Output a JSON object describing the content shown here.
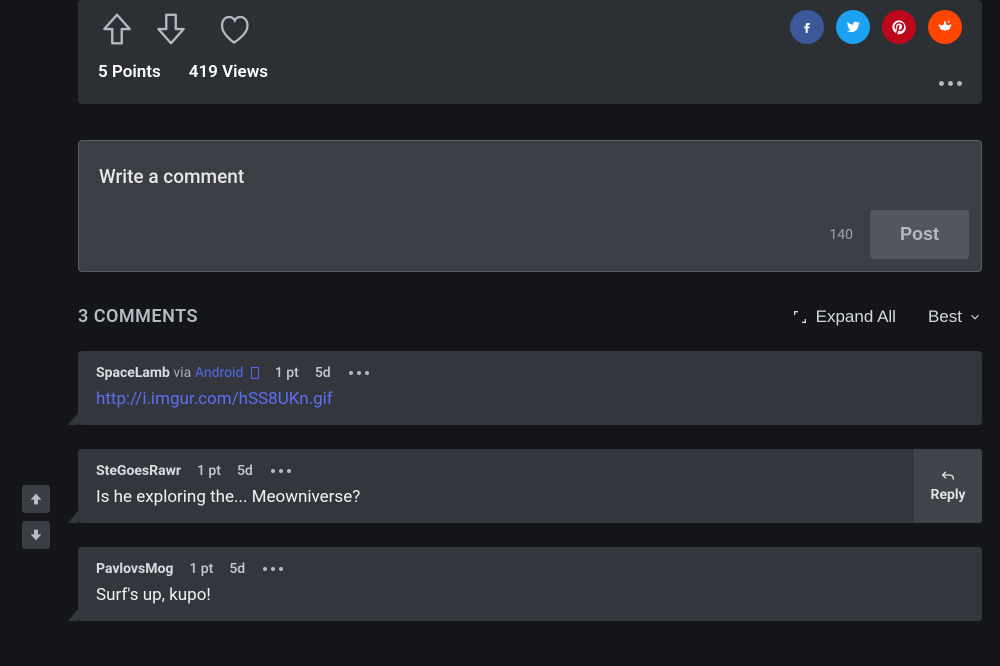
{
  "post": {
    "points_label": "5 Points",
    "views_label": "419 Views"
  },
  "compose": {
    "placeholder": "Write a comment",
    "char_limit": "140",
    "post_label": "Post"
  },
  "comments_header": {
    "title": "3 COMMENTS",
    "expand_label": "Expand All",
    "sort_label": "Best"
  },
  "comments": [
    {
      "author": "SpaceLamb",
      "via": "via",
      "via_platform": "Android",
      "points": "1 pt",
      "age": "5d",
      "body_link": "http://i.imgur.com/hSS8UKn.gif"
    },
    {
      "author": "SteGoesRawr",
      "points": "1 pt",
      "age": "5d",
      "body": "Is he exploring the... Meowniverse?",
      "reply_label": "Reply"
    },
    {
      "author": "PavlovsMog",
      "points": "1 pt",
      "age": "5d",
      "body": "Surf's up, kupo!"
    }
  ]
}
